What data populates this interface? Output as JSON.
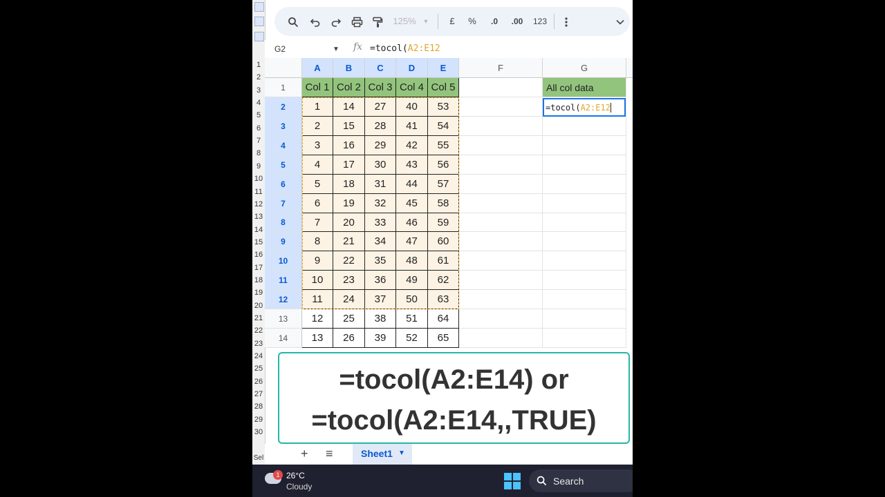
{
  "toolbar": {
    "zoom": "125%",
    "currency": "£",
    "percent": "%",
    "decrease_decimals": ".0",
    "increase_decimals": ".00",
    "number_format": "123"
  },
  "formula_bar": {
    "cell_ref": "G2",
    "fx_symbol": "fx",
    "formula_prefix": "=tocol(",
    "formula_range": "A2:E12"
  },
  "columns": [
    "A",
    "B",
    "C",
    "D",
    "E",
    "F",
    "G"
  ],
  "rows": [
    "1",
    "2",
    "3",
    "4",
    "5",
    "6",
    "7",
    "8",
    "9",
    "10",
    "11",
    "12",
    "13",
    "14"
  ],
  "header_row": [
    "Col 1",
    "Col 2",
    "Col 3",
    "Col 4",
    "Col 5"
  ],
  "table": [
    [
      1,
      14,
      27,
      40,
      53
    ],
    [
      2,
      15,
      28,
      41,
      54
    ],
    [
      3,
      16,
      29,
      42,
      55
    ],
    [
      4,
      17,
      30,
      43,
      56
    ],
    [
      5,
      18,
      31,
      44,
      57
    ],
    [
      6,
      19,
      32,
      45,
      58
    ],
    [
      7,
      20,
      33,
      46,
      59
    ],
    [
      8,
      21,
      34,
      47,
      60
    ],
    [
      9,
      22,
      35,
      48,
      61
    ],
    [
      10,
      23,
      36,
      49,
      62
    ],
    [
      11,
      24,
      37,
      50,
      63
    ],
    [
      12,
      25,
      38,
      51,
      64
    ],
    [
      13,
      26,
      39,
      52,
      65
    ]
  ],
  "g_header": "All col data",
  "active_cell": {
    "prefix": "=tocol(",
    "range": "A2:E12"
  },
  "caption": {
    "line1": "=tocol(A2:E14) or",
    "line2": "=tocol(A2:E14,,TRUE)"
  },
  "sheet_tabs": {
    "active": "Sheet1"
  },
  "taskbar": {
    "badge": "1",
    "temperature": "26°C",
    "condition": "Cloudy",
    "search_label": "Search"
  },
  "background_window": {
    "row_numbers": [
      "1",
      "2",
      "3",
      "4",
      "5",
      "6",
      "7",
      "8",
      "9",
      "10",
      "11",
      "12",
      "13",
      "14",
      "15",
      "16",
      "17",
      "18",
      "19",
      "20",
      "21",
      "22",
      "23",
      "24",
      "25",
      "26",
      "27",
      "28",
      "29",
      "30"
    ],
    "status_text": "Sel"
  },
  "colors": {
    "header_green": "#93c47d",
    "range_orange": "#e2a52b",
    "selection_blue": "#1a73e8",
    "caption_border": "#22b8a5"
  }
}
